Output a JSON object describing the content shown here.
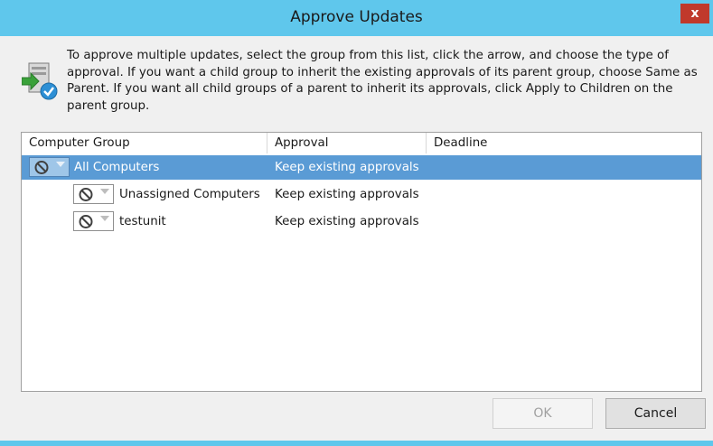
{
  "window": {
    "title": "Approve Updates",
    "close_glyph": "x"
  },
  "info": {
    "icon": "approve-updates-icon",
    "text": "To approve multiple updates, select the group from this list, click the arrow, and choose the type of approval. If you want a child group to inherit the existing approvals of its parent group, choose Same as Parent. If you want all child groups of a parent to inherit its approvals, click Apply to Children on the parent group."
  },
  "table": {
    "headers": {
      "group": "Computer Group",
      "approval": "Approval",
      "deadline": "Deadline"
    },
    "rows": [
      {
        "name": "All Computers",
        "approval": "Keep existing approvals",
        "deadline": "",
        "selected": true,
        "indent_level": 0,
        "status_icon": "not-approved-icon"
      },
      {
        "name": "Unassigned Computers",
        "approval": "Keep existing approvals",
        "deadline": "",
        "selected": false,
        "indent_level": 1,
        "status_icon": "not-approved-icon"
      },
      {
        "name": "testunit",
        "approval": "Keep existing approvals",
        "deadline": "",
        "selected": false,
        "indent_level": 1,
        "status_icon": "not-approved-icon"
      }
    ]
  },
  "buttons": {
    "ok": "OK",
    "ok_enabled": false,
    "cancel": "Cancel"
  },
  "colors": {
    "titlebar": "#5fc7ec",
    "selection": "#5a9bd5",
    "close": "#c0392b"
  }
}
